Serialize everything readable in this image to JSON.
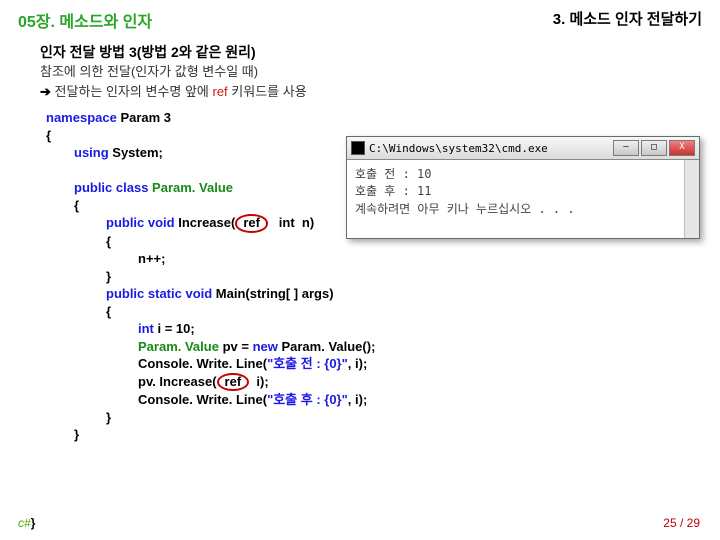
{
  "header": {
    "chapter": "05장. 메소드와 인자",
    "section": "3. 메소드 인자 전달하기"
  },
  "sub": {
    "title": "인자 전달 방법 3(방법 2와 같은 원리)",
    "line1": "참조에 의한  전달(인자가 값형 변수일 때)",
    "arrow": "➔",
    "line2a": " 전달하는 인자의 변수명 앞에 ",
    "ref": "ref",
    "line2b": " 키워드를 사용"
  },
  "code": {
    "l1a": "namespace ",
    "l1b": "Param 3",
    "l2": "{",
    "l3a": "using ",
    "l3b": "System;",
    "l5a": "public class ",
    "l5b": "Param. Value",
    "l6": "{",
    "l7a": "public void ",
    "l7b": "Increase(",
    "l7ref": "ref",
    "l7c": "   int  n)",
    "l8": "{",
    "l9": "n++;",
    "l10": "}",
    "l11a": "public static void ",
    "l11b": "Main(string[ ] args)",
    "l12": "{",
    "l13a": "int ",
    "l13b": "i = 10;",
    "l14a": "Param. Value ",
    "l14b": "pv = ",
    "l14c": "new ",
    "l14d": "Param. Value();",
    "l15a": "Console. Write. Line(",
    "l15b": "\"호출 전 : {0}\"",
    "l15c": ", i);",
    "l16a": "pv. Increase(",
    "l16ref": "ref",
    "l16b": "  i);",
    "l17a": "Console. Write. Line(",
    "l17b": "\"호출 후 : {0}\"",
    "l17c": ", i);",
    "l18": "}",
    "l19": "}",
    "l20": "}"
  },
  "console": {
    "title": "C:\\Windows\\system32\\cmd.exe",
    "min": "–",
    "max": "□",
    "close": "X",
    "line1": "호출 전 : 10",
    "line2": "호출 후 : 11",
    "line3": "계속하려면 아무 키나 누르십시오 . . ."
  },
  "footer": {
    "csharp": "c#",
    "page": "25 / 29"
  }
}
